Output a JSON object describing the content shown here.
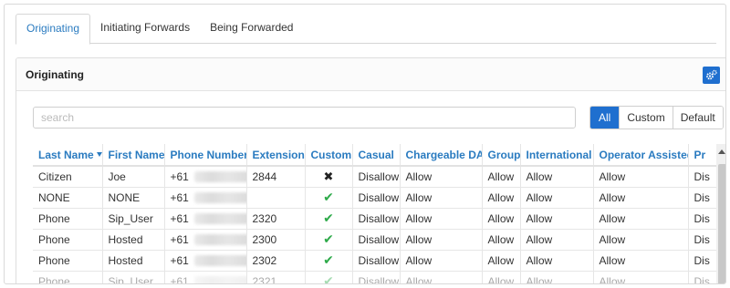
{
  "tabs": [
    {
      "label": "Originating"
    },
    {
      "label": "Initiating Forwards"
    },
    {
      "label": "Being Forwarded"
    }
  ],
  "panel": {
    "title": "Originating"
  },
  "search": {
    "placeholder": "search"
  },
  "filter": {
    "options": [
      "All",
      "Custom",
      "Default"
    ],
    "selected": "All"
  },
  "table": {
    "columns": [
      "Last Name",
      "First Name",
      "Phone Number",
      "Extension",
      "Custom",
      "Casual",
      "Chargeable DA",
      "Group",
      "International",
      "Operator Assisted",
      "Pr"
    ],
    "sorted_column": "Last Name",
    "rows": [
      {
        "last": "Citizen",
        "first": "Joe",
        "phone": "+61",
        "ext": "2844",
        "custom": "cross",
        "casual": "Disallow",
        "chargeable": "Allow",
        "group": "Allow",
        "intl": "Allow",
        "operator": "Allow",
        "pr": "Dis"
      },
      {
        "last": "NONE",
        "first": "NONE",
        "phone": "+61",
        "ext": "",
        "custom": "check",
        "casual": "Disallow",
        "chargeable": "Allow",
        "group": "Allow",
        "intl": "Allow",
        "operator": "Allow",
        "pr": "Dis"
      },
      {
        "last": "Phone",
        "first": "Sip_User",
        "phone": "+61",
        "ext": "2320",
        "custom": "check",
        "casual": "Disallow",
        "chargeable": "Allow",
        "group": "Allow",
        "intl": "Allow",
        "operator": "Allow",
        "pr": "Dis"
      },
      {
        "last": "Phone",
        "first": "Hosted",
        "phone": "+61",
        "ext": "2300",
        "custom": "check",
        "casual": "Disallow",
        "chargeable": "Allow",
        "group": "Allow",
        "intl": "Allow",
        "operator": "Allow",
        "pr": "Dis"
      },
      {
        "last": "Phone",
        "first": "Hosted",
        "phone": "+61",
        "ext": "2302",
        "custom": "check",
        "casual": "Disallow",
        "chargeable": "Allow",
        "group": "Allow",
        "intl": "Allow",
        "operator": "Allow",
        "pr": "Dis"
      },
      {
        "last": "Phone",
        "first": "Sip_User",
        "phone": "+61",
        "ext": "2321",
        "custom": "check",
        "casual": "Disallow",
        "chargeable": "Allow",
        "group": "Allow",
        "intl": "Allow",
        "operator": "Allow",
        "pr": "Dis"
      }
    ]
  },
  "icons": {
    "panel_button": "cogs-icon",
    "custom_yes": "check-icon",
    "custom_no": "cross-icon"
  },
  "colors": {
    "accent": "#2a7bc0",
    "button": "#1f6fcf",
    "check": "#2eaa4a"
  }
}
